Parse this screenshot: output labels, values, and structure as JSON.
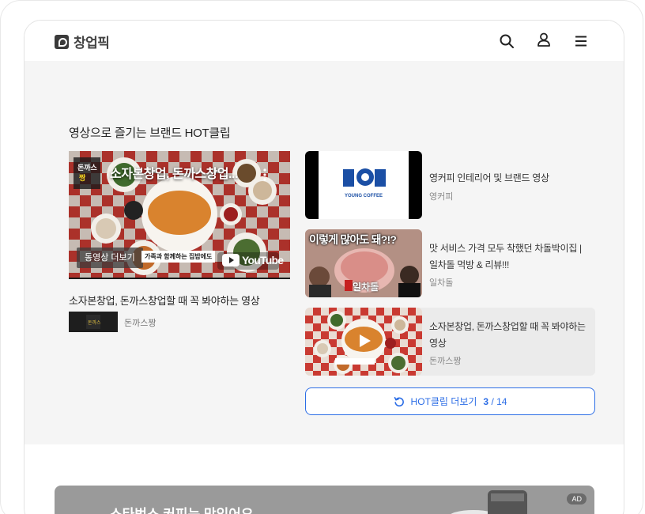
{
  "header": {
    "logo_text": "창업픽",
    "icons": [
      "search-icon",
      "user-icon",
      "menu-icon"
    ]
  },
  "section": {
    "title": "영상으로 즐기는 브랜드 HOT클립"
  },
  "main_video": {
    "overlay_title": "소자본창업, 돈까스창업...",
    "more_label": "동영상 더보기",
    "subtitle_text": "가족과 함께하는 집밥에도",
    "youtube_label": "YouTube",
    "caption": "소자본창업, 돈까스창업할 때 꼭 봐야하는 영상",
    "channel": "돈까스짱"
  },
  "clips": [
    {
      "title": "영커피 인테리어 및 브랜드 영상",
      "channel": "영커피",
      "thumb_text": "YOUNG COFFEE"
    },
    {
      "title": "맛 서비스 가격 모두 착했던 차돌박이집 | 일차돌 먹방 & 리뷰!!!",
      "channel": "일차돌",
      "thumb_text": "이렇게 많아도 돼?!?",
      "thumb_sub": "일차돌"
    },
    {
      "title": "소자본창업, 돈까스창업할 때 꼭 봐야하는 영상",
      "channel": "돈까스짱"
    }
  ],
  "more_button": {
    "label": "HOT클립 더보기",
    "current": "3",
    "total": "/ 14"
  },
  "ad": {
    "text": "스타벅스 커피는 맛있어요",
    "badge": "AD"
  },
  "colors": {
    "accent": "#2d6ee6",
    "background": "#f5f5f5"
  }
}
